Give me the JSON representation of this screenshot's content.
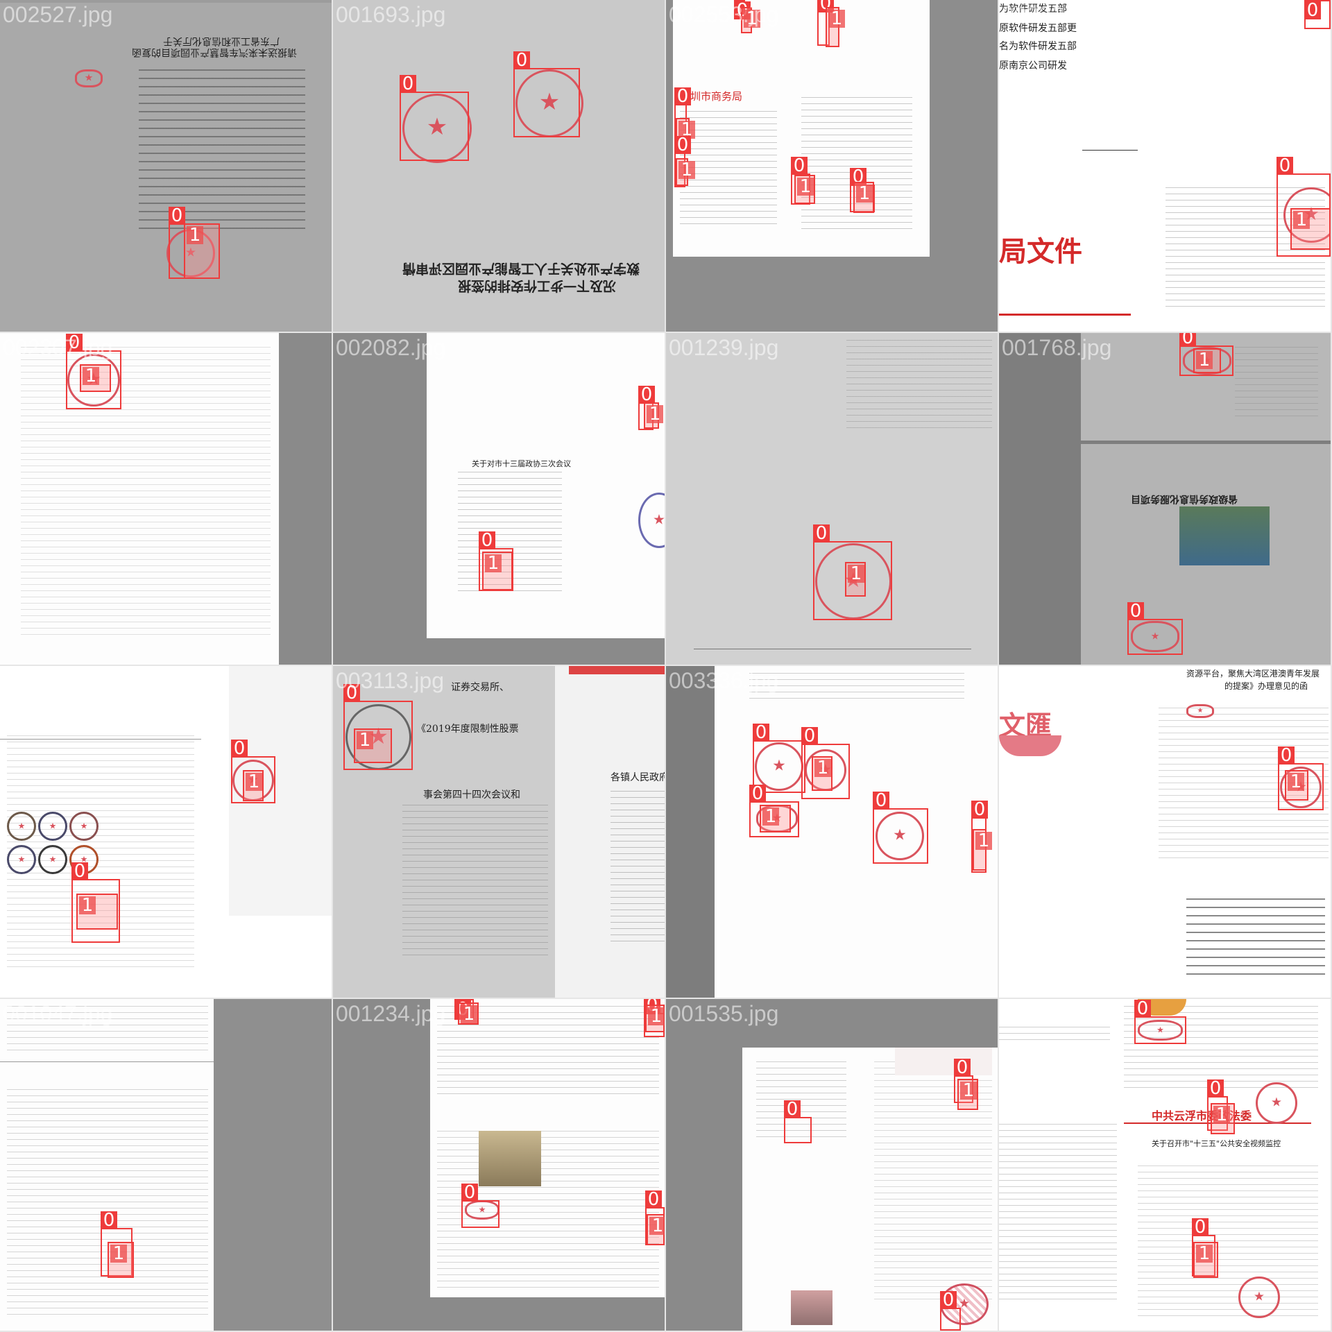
{
  "tiles": [
    {
      "filename": "002527.jpg"
    },
    {
      "filename": "001693.jpg"
    },
    {
      "filename": "002553.jpg"
    },
    {
      "filename": "003324.jpg"
    },
    {
      "filename": "002307.jpg"
    },
    {
      "filename": "002082.jpg"
    },
    {
      "filename": "001239.jpg"
    },
    {
      "filename": "001768.jpg"
    },
    {
      "filename": "002577.jpg"
    },
    {
      "filename": "003113.jpg"
    },
    {
      "filename": "003336.jpg"
    },
    {
      "filename": "002007.jpg"
    },
    {
      "filename": "001047.jpg"
    },
    {
      "filename": "001234.jpg"
    },
    {
      "filename": "001535.jpg"
    },
    {
      "filename": "002150.jpg"
    }
  ],
  "labels": {
    "class0": "0",
    "class1": "1"
  },
  "doc_text": {
    "t1_title_a": "广东省工业和信息化厅关于",
    "t1_title_b": "请报送未来汽车智慧产业园项目的复函",
    "t2_title_a": "数字产业处关于人工智能产业园区评审情",
    "t2_title_b": "况及下一步工作安排的签报",
    "t3_header": "深圳市商务局",
    "t4_a": "为软件研发五部",
    "t4_b": "原软件研发五部更",
    "t4_c": "名为软件研发五部",
    "t4_d": "原南京公司研发",
    "t4_red": "局文件",
    "t6_title": "关于对市十三届政协三次会议",
    "t8_title": "省级政务信息化服务项目",
    "t10_a": "证券交易所、",
    "t10_b": "《2019年度限制性股票",
    "t10_c": "事会第四十四次会议和",
    "t10_d": "各镇人民政府",
    "t12_a": "资源平台，聚焦大湾区港澳青年发展",
    "t12_b": "的提案》办理意见的函",
    "t12_c": "文匯",
    "t16_red": "中共云浮市委政法委",
    "t16_title": "关于召开市\"十三五\"公共安全视频监控"
  },
  "colors": {
    "box": "#ee3b3b",
    "seal": "#d9545e",
    "red_header": "#d42a2a"
  }
}
